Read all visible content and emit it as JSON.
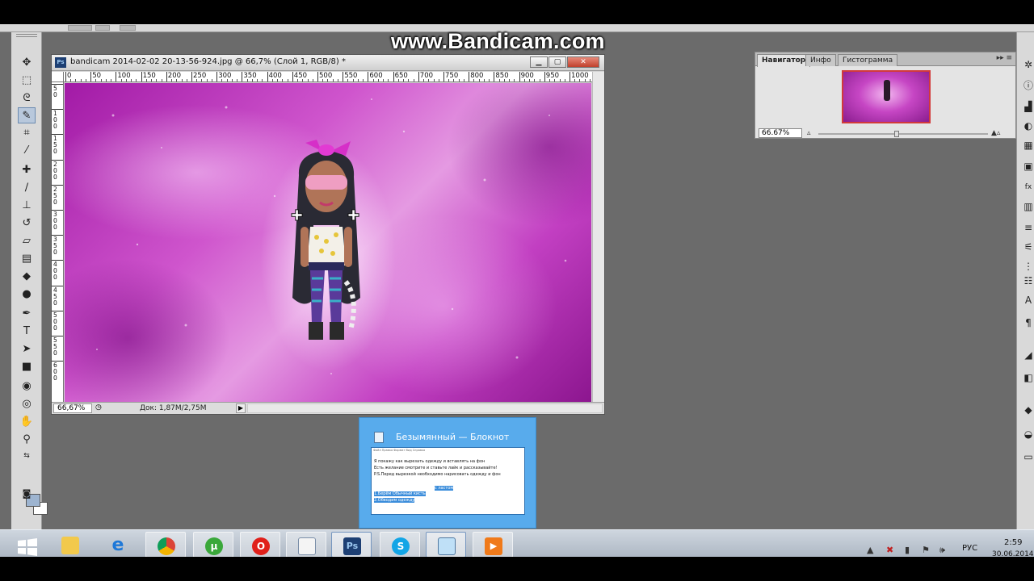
{
  "watermark": "www.Bandicam.com",
  "document": {
    "title": "bandicam 2014-02-02 20-13-56-924.jpg @ 66,7% (Слой 1, RGB/8) *",
    "app_badge": "Ps",
    "zoom": "66,67%",
    "doc_info": "Док: 1,87M/2,75M",
    "ruler_top_labels": [
      "0",
      "50",
      "100",
      "150",
      "200",
      "250",
      "300",
      "350",
      "400",
      "450",
      "500",
      "550",
      "600",
      "650",
      "700",
      "750",
      "800",
      "850",
      "900",
      "950",
      "1000"
    ],
    "ruler_left_labels": [
      "5\n0",
      "1\n0\n0",
      "1\n5\n0",
      "2\n0\n0",
      "2\n5\n0",
      "3\n0\n0",
      "3\n5\n0",
      "4\n0\n0",
      "4\n5\n0",
      "5\n0\n0",
      "5\n5\n0",
      "6\n0\n0"
    ]
  },
  "navigator": {
    "tabs": [
      "Навигатор",
      "Инфо",
      "Гистограмма"
    ],
    "active_tab": "Навигатор",
    "zoom": "66.67%"
  },
  "notepad_preview": {
    "title": "Безымянный — Блокнот",
    "menu": "Файл  Правка  Формат  Вид  Справка",
    "lines": [
      "Я покажу как вырезать одежду и вставлять на фон",
      "Есть желание смотрите и ставьте лайк и рассказывайте!",
      "P.S.Перед вырезкой необходимо нарисовать одежду и фон",
      "1.Берём Обычный кисть",
      "2.Обводим одежду"
    ],
    "selected_fragment": "с ластом"
  },
  "taskbar": {
    "apps": [
      {
        "name": "explorer",
        "label": ""
      },
      {
        "name": "internet-explorer",
        "label": "e"
      },
      {
        "name": "chrome",
        "label": ""
      },
      {
        "name": "utorrent",
        "label": "µ"
      },
      {
        "name": "opera",
        "label": "O"
      },
      {
        "name": "word",
        "label": ""
      },
      {
        "name": "photoshop",
        "label": "Ps"
      },
      {
        "name": "skype",
        "label": "S"
      },
      {
        "name": "notepad",
        "label": ""
      },
      {
        "name": "bandicam",
        "label": "▶"
      }
    ],
    "language": "РУС",
    "time": "2:59",
    "date": "30.06.2014"
  },
  "colors": {
    "foreground": "#9db4d0",
    "background": "#ffffff",
    "ps_blue": "#1d3f73",
    "notepad_bg": "#58abec"
  }
}
